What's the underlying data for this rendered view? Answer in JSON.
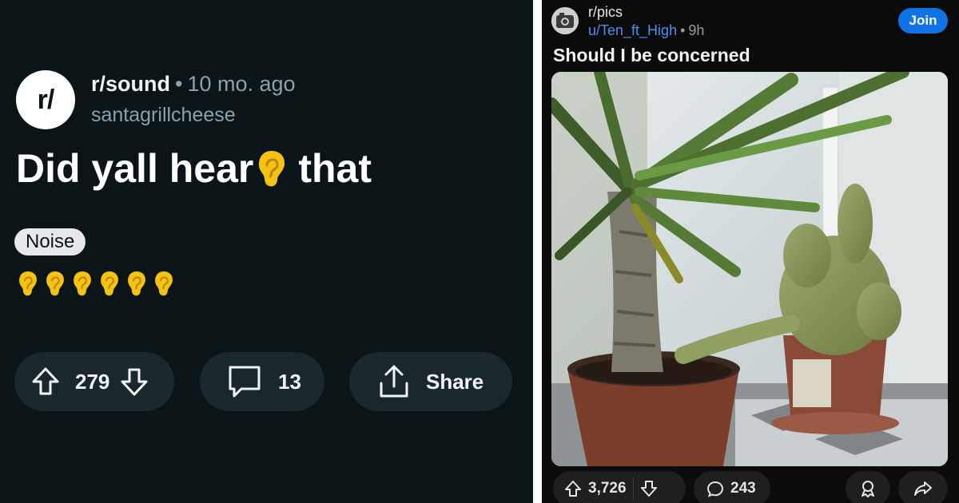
{
  "left_post": {
    "avatar_text": "r/",
    "subreddit": "r/sound",
    "separator": "•",
    "time": "10 mo. ago",
    "username": "santagrillcheese",
    "title_before": "Did yall hear",
    "title_after": "that",
    "flair": "Noise",
    "ear_count": 6,
    "votes": "279",
    "comments": "13",
    "share_label": "Share",
    "colors": {
      "background": "#0b1416",
      "pill": "#1a282d",
      "text": "#ffffff",
      "muted": "#8ba2ad",
      "ear": "#f5c211"
    }
  },
  "right_post": {
    "subreddit": "r/pics",
    "username": "u/Ten_ft_High",
    "separator": "•",
    "time": "9h",
    "join_label": "Join",
    "title": "Should I be concerned",
    "votes": "3,726",
    "comments": "243",
    "colors": {
      "background": "#0b0b0b",
      "join": "#0f73e6",
      "username": "#4c8df6",
      "pill": "#1f1f1f"
    }
  }
}
